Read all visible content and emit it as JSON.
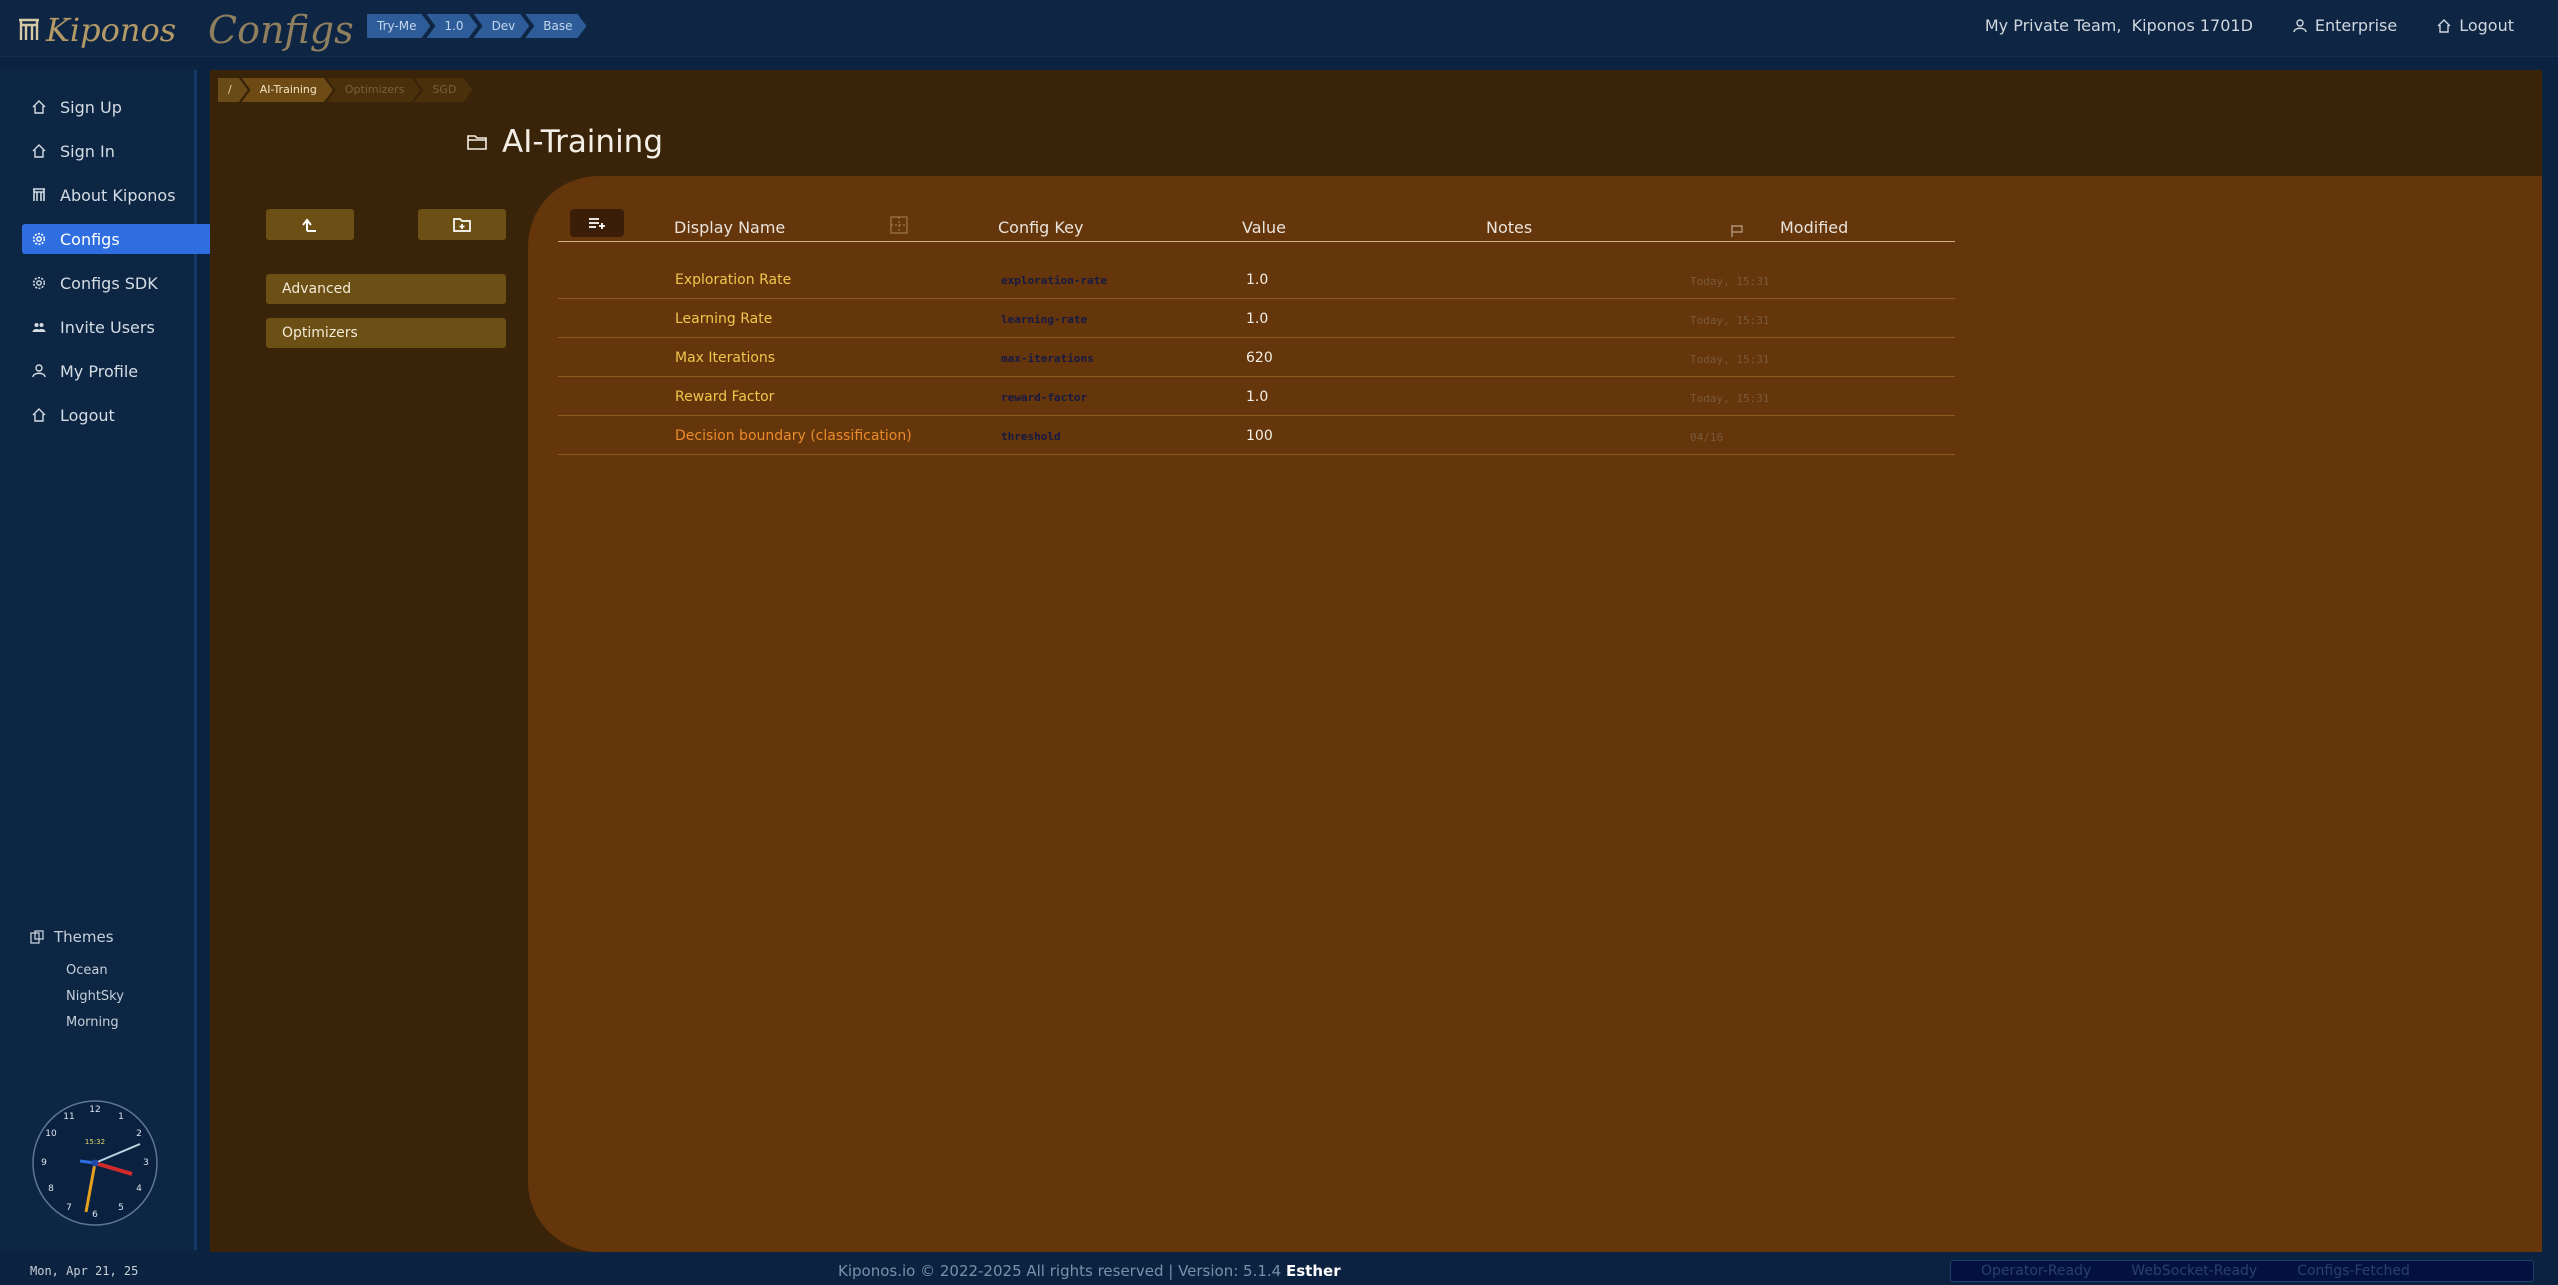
{
  "brand": {
    "logo_text": "Kiponos",
    "app_title": "Configs"
  },
  "env_chips": [
    "Try-Me",
    "1.0",
    "Dev",
    "Base"
  ],
  "top_right": {
    "team": "My Private Team,  Kiponos 1701D",
    "plan": "Enterprise",
    "logout": "Logout"
  },
  "sidebar": {
    "items": [
      {
        "label": "Sign Up",
        "icon": "home-icon"
      },
      {
        "label": "Sign In",
        "icon": "home-icon"
      },
      {
        "label": "About Kiponos",
        "icon": "building-icon"
      },
      {
        "label": "Configs",
        "icon": "gear-icon",
        "active": true
      },
      {
        "label": "Configs SDK",
        "icon": "gear-icon"
      },
      {
        "label": "Invite Users",
        "icon": "users-icon"
      },
      {
        "label": "My Profile",
        "icon": "user-icon"
      },
      {
        "label": "Logout",
        "icon": "home-icon"
      }
    ],
    "themes_label": "Themes",
    "themes": [
      "Ocean",
      "NightSky",
      "Morning"
    ],
    "clock_digital": "15:32"
  },
  "breadcrumb": [
    "/",
    "AI-Training",
    "Optimizers",
    "SGD"
  ],
  "page_title": "AI-Training",
  "folders": [
    "Advanced",
    "Optimizers"
  ],
  "table": {
    "headers": {
      "display_name": "Display Name",
      "config_key": "Config Key",
      "value": "Value",
      "notes": "Notes",
      "modified": "Modified"
    },
    "rows": [
      {
        "name": "Exploration Rate",
        "key": "exploration-rate",
        "value": "1.0",
        "notes": "",
        "modified": "Today, 15:31"
      },
      {
        "name": "Learning Rate",
        "key": "learning-rate",
        "value": "1.0",
        "notes": "",
        "modified": "Today, 15:31"
      },
      {
        "name": "Max Iterations",
        "key": "max-iterations",
        "value": "620",
        "notes": "",
        "modified": "Today, 15:31"
      },
      {
        "name": "Reward Factor",
        "key": "reward-factor",
        "value": "1.0",
        "notes": "",
        "modified": "Today, 15:31"
      },
      {
        "name": "Decision boundary (classification)",
        "key": "threshold",
        "value": "100",
        "notes": "",
        "modified": "04/16"
      }
    ]
  },
  "footer": {
    "date": "Mon, Apr 21, 25",
    "copyright": "Kiponos.io © 2022-2025 All rights reserved | Version: 5.1.4",
    "version_name": "Esther",
    "status": [
      "Operator-Ready",
      "WebSocket-Ready",
      "Configs-Fetched"
    ]
  },
  "colors": {
    "accent": "#2f6ee0",
    "bg": "#0b2340",
    "content": "#65350b",
    "name_text": "#f0c64c"
  }
}
